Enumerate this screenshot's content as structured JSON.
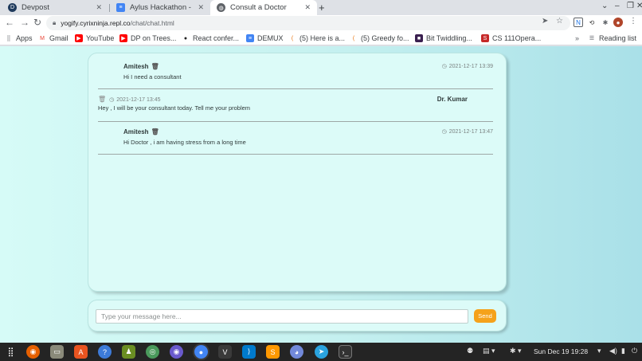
{
  "browser": {
    "tabs": [
      {
        "title": "Devpost",
        "active": false
      },
      {
        "title": "Aylus Hackathon - Goog",
        "active": false
      },
      {
        "title": "Consult a Doctor",
        "active": true
      }
    ],
    "url_host": "yogify.cyrixninja.repl.co",
    "url_path": "/chat/chat.html",
    "bookmarks": [
      {
        "label": "Apps"
      },
      {
        "label": "Gmail"
      },
      {
        "label": "YouTube"
      },
      {
        "label": "DP on Trees..."
      },
      {
        "label": "React confer..."
      },
      {
        "label": "DEMUX"
      },
      {
        "label": "(5) Here is a..."
      },
      {
        "label": "(5) Greedy fo..."
      },
      {
        "label": "Bit Twiddling..."
      },
      {
        "label": "CS 111Opera..."
      }
    ],
    "reading_list": "Reading list"
  },
  "chat": {
    "messages": [
      {
        "role": "user",
        "sender": "Amitesh",
        "time": "2021-12-17 13:39",
        "text": "Hi I need a consultant"
      },
      {
        "role": "doctor",
        "sender": "Dr. Kumar",
        "time": "2021-12-17 13:45",
        "text": "Hey , I will be your consultant today. Tell me your problem"
      },
      {
        "role": "user",
        "sender": "Amitesh",
        "time": "2021-12-17 13:47",
        "text": "Hi Doctor , i am having stress from a long time"
      }
    ],
    "input_placeholder": "Type your message here...",
    "send_label": "Send"
  },
  "taskbar": {
    "clock": "Sun Dec 19  19:28"
  },
  "colors": {
    "accent_send": "#f5a21b",
    "chat_bg": "#dcfbf8",
    "taskbar_bg": "#242424"
  }
}
